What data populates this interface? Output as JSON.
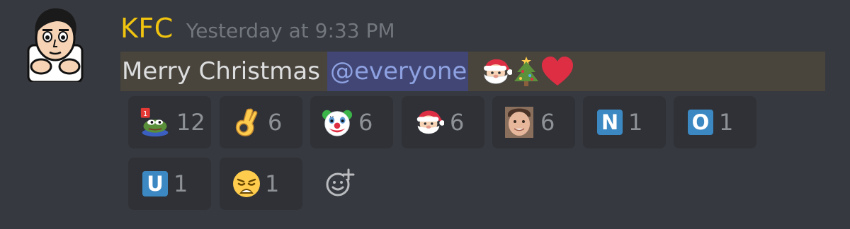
{
  "author": {
    "name": "KFC",
    "name_color": "#f1c40f",
    "avatar_icon": "cartoon-face-avatar"
  },
  "message": {
    "timestamp": "Yesterday at 9:33 PM",
    "text": "Merry Christmas",
    "mention": "@everyone",
    "emojis": [
      "santa-emoji",
      "christmas-tree-emoji",
      "red-heart-emoji"
    ],
    "highlight_color": "#49443c"
  },
  "reactions": [
    {
      "icon": "pepe-frog-emoji",
      "count": "12",
      "badge": "1"
    },
    {
      "icon": "ok-hand-emoji",
      "count": "6"
    },
    {
      "icon": "clown-face-emoji",
      "count": "6"
    },
    {
      "icon": "santa-emoji",
      "count": "6"
    },
    {
      "icon": "custom-face-photo-emoji",
      "count": "6"
    },
    {
      "icon": "letter-n-emoji",
      "count": "1",
      "letter": "N"
    },
    {
      "icon": "letter-o-emoji",
      "count": "1",
      "letter": "O"
    },
    {
      "icon": "letter-u-emoji",
      "count": "1",
      "letter": "U"
    },
    {
      "icon": "weary-face-emoji",
      "count": "1"
    }
  ],
  "add_reaction_icon": "add-reaction-icon"
}
